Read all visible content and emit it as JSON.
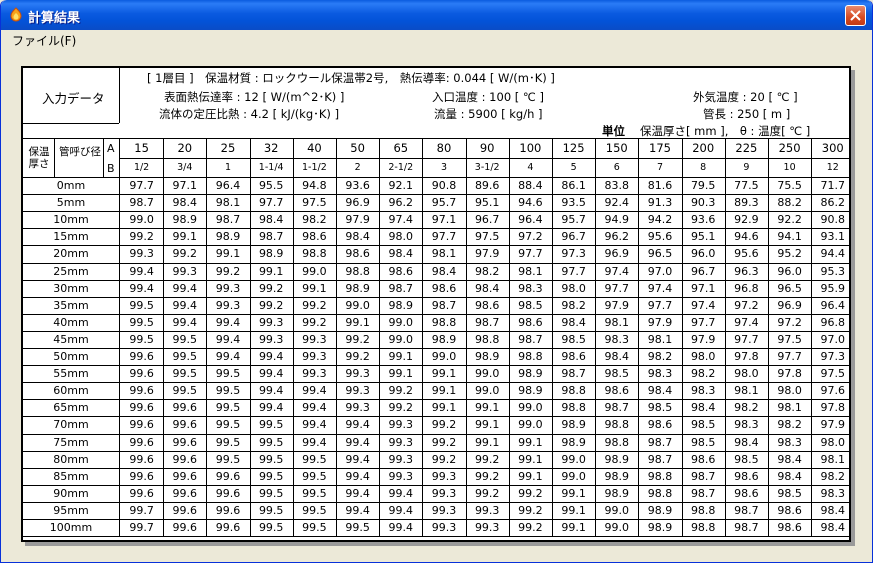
{
  "window": {
    "title": "計算結果"
  },
  "menu": {
    "file": "ファイル(F)"
  },
  "info": {
    "input_label": "入力データ",
    "line1": "[ 1層目 ]　保温材質 : ロックウール保温帯2号,　熱伝導率: 0.044 [ W/(m･K) ]",
    "surface": "表面熱伝達率 : 12 [ W/(m^2･K) ]",
    "inlet": "入口温度 : 100 [ ℃ ]",
    "outside": "外気温度 : 20 [ ℃ ]",
    "specific_heat": "流体の定圧比熱 : 4.2 [ kJ/(kg･K) ]",
    "flow": "流量 : 5900 [ kg/h ]",
    "length": "管長 : 250 [ m ]",
    "unit_label": "単位",
    "unit_text": "保温厚さ[ mm ],　θ : 温度[ ℃ ]"
  },
  "table": {
    "header_thickness": "保温厚さ",
    "header_pipe": "管呼び径",
    "row_a": "A",
    "row_b": "B",
    "sizes_a": [
      "15",
      "20",
      "25",
      "32",
      "40",
      "50",
      "65",
      "80",
      "90",
      "100",
      "125",
      "150",
      "175",
      "200",
      "225",
      "250",
      "300"
    ],
    "sizes_b": [
      "1/2",
      "3/4",
      "1",
      "1-1/4",
      "1-1/2",
      "2",
      "2-1/2",
      "3",
      "3-1/2",
      "4",
      "5",
      "6",
      "7",
      "8",
      "9",
      "10",
      "12"
    ],
    "rows": [
      {
        "label": "0mm",
        "values": [
          "97.7",
          "97.1",
          "96.4",
          "95.5",
          "94.8",
          "93.6",
          "92.1",
          "90.8",
          "89.6",
          "88.4",
          "86.1",
          "83.8",
          "81.6",
          "79.5",
          "77.5",
          "75.5",
          "71.7"
        ]
      },
      {
        "label": "5mm",
        "values": [
          "98.7",
          "98.4",
          "98.1",
          "97.7",
          "97.5",
          "96.9",
          "96.2",
          "95.7",
          "95.1",
          "94.6",
          "93.5",
          "92.4",
          "91.3",
          "90.3",
          "89.3",
          "88.2",
          "86.2"
        ]
      },
      {
        "label": "10mm",
        "values": [
          "99.0",
          "98.9",
          "98.7",
          "98.4",
          "98.2",
          "97.9",
          "97.4",
          "97.1",
          "96.7",
          "96.4",
          "95.7",
          "94.9",
          "94.2",
          "93.6",
          "92.9",
          "92.2",
          "90.8"
        ]
      },
      {
        "label": "15mm",
        "values": [
          "99.2",
          "99.1",
          "98.9",
          "98.7",
          "98.6",
          "98.4",
          "98.0",
          "97.7",
          "97.5",
          "97.2",
          "96.7",
          "96.2",
          "95.6",
          "95.1",
          "94.6",
          "94.1",
          "93.1"
        ]
      },
      {
        "label": "20mm",
        "values": [
          "99.3",
          "99.2",
          "99.1",
          "98.9",
          "98.8",
          "98.6",
          "98.4",
          "98.1",
          "97.9",
          "97.7",
          "97.3",
          "96.9",
          "96.5",
          "96.0",
          "95.6",
          "95.2",
          "94.4"
        ]
      },
      {
        "label": "25mm",
        "values": [
          "99.4",
          "99.3",
          "99.2",
          "99.1",
          "99.0",
          "98.8",
          "98.6",
          "98.4",
          "98.2",
          "98.1",
          "97.7",
          "97.4",
          "97.0",
          "96.7",
          "96.3",
          "96.0",
          "95.3"
        ]
      },
      {
        "label": "30mm",
        "values": [
          "99.4",
          "99.4",
          "99.3",
          "99.2",
          "99.1",
          "98.9",
          "98.7",
          "98.6",
          "98.4",
          "98.3",
          "98.0",
          "97.7",
          "97.4",
          "97.1",
          "96.8",
          "96.5",
          "95.9"
        ]
      },
      {
        "label": "35mm",
        "values": [
          "99.5",
          "99.4",
          "99.3",
          "99.2",
          "99.2",
          "99.0",
          "98.9",
          "98.7",
          "98.6",
          "98.5",
          "98.2",
          "97.9",
          "97.7",
          "97.4",
          "97.2",
          "96.9",
          "96.4"
        ]
      },
      {
        "label": "40mm",
        "values": [
          "99.5",
          "99.4",
          "99.4",
          "99.3",
          "99.2",
          "99.1",
          "99.0",
          "98.8",
          "98.7",
          "98.6",
          "98.4",
          "98.1",
          "97.9",
          "97.7",
          "97.4",
          "97.2",
          "96.8"
        ]
      },
      {
        "label": "45mm",
        "values": [
          "99.5",
          "99.5",
          "99.4",
          "99.3",
          "99.3",
          "99.2",
          "99.0",
          "98.9",
          "98.8",
          "98.7",
          "98.5",
          "98.3",
          "98.1",
          "97.9",
          "97.7",
          "97.5",
          "97.0"
        ]
      },
      {
        "label": "50mm",
        "values": [
          "99.6",
          "99.5",
          "99.4",
          "99.4",
          "99.3",
          "99.2",
          "99.1",
          "99.0",
          "98.9",
          "98.8",
          "98.6",
          "98.4",
          "98.2",
          "98.0",
          "97.8",
          "97.7",
          "97.3"
        ]
      },
      {
        "label": "55mm",
        "values": [
          "99.6",
          "99.5",
          "99.5",
          "99.4",
          "99.3",
          "99.3",
          "99.1",
          "99.1",
          "99.0",
          "98.9",
          "98.7",
          "98.5",
          "98.3",
          "98.2",
          "98.0",
          "97.8",
          "97.5"
        ]
      },
      {
        "label": "60mm",
        "values": [
          "99.6",
          "99.5",
          "99.5",
          "99.4",
          "99.4",
          "99.3",
          "99.2",
          "99.1",
          "99.0",
          "98.9",
          "98.8",
          "98.6",
          "98.4",
          "98.3",
          "98.1",
          "98.0",
          "97.6"
        ]
      },
      {
        "label": "65mm",
        "values": [
          "99.6",
          "99.6",
          "99.5",
          "99.4",
          "99.4",
          "99.3",
          "99.2",
          "99.1",
          "99.1",
          "99.0",
          "98.8",
          "98.7",
          "98.5",
          "98.4",
          "98.2",
          "98.1",
          "97.8"
        ]
      },
      {
        "label": "70mm",
        "values": [
          "99.6",
          "99.6",
          "99.5",
          "99.5",
          "99.4",
          "99.4",
          "99.3",
          "99.2",
          "99.1",
          "99.0",
          "98.9",
          "98.8",
          "98.6",
          "98.5",
          "98.3",
          "98.2",
          "97.9"
        ]
      },
      {
        "label": "75mm",
        "values": [
          "99.6",
          "99.6",
          "99.5",
          "99.5",
          "99.4",
          "99.4",
          "99.3",
          "99.2",
          "99.1",
          "99.1",
          "98.9",
          "98.8",
          "98.7",
          "98.5",
          "98.4",
          "98.3",
          "98.0"
        ]
      },
      {
        "label": "80mm",
        "values": [
          "99.6",
          "99.6",
          "99.5",
          "99.5",
          "99.5",
          "99.4",
          "99.3",
          "99.2",
          "99.2",
          "99.1",
          "99.0",
          "98.9",
          "98.7",
          "98.6",
          "98.5",
          "98.4",
          "98.1"
        ]
      },
      {
        "label": "85mm",
        "values": [
          "99.6",
          "99.6",
          "99.6",
          "99.5",
          "99.5",
          "99.4",
          "99.3",
          "99.3",
          "99.2",
          "99.1",
          "99.0",
          "98.9",
          "98.8",
          "98.7",
          "98.6",
          "98.4",
          "98.2"
        ]
      },
      {
        "label": "90mm",
        "values": [
          "99.6",
          "99.6",
          "99.6",
          "99.5",
          "99.5",
          "99.4",
          "99.4",
          "99.3",
          "99.2",
          "99.2",
          "99.1",
          "98.9",
          "98.8",
          "98.7",
          "98.6",
          "98.5",
          "98.3"
        ]
      },
      {
        "label": "95mm",
        "values": [
          "99.7",
          "99.6",
          "99.6",
          "99.5",
          "99.5",
          "99.4",
          "99.4",
          "99.3",
          "99.3",
          "99.2",
          "99.1",
          "99.0",
          "98.9",
          "98.8",
          "98.7",
          "98.6",
          "98.4"
        ]
      },
      {
        "label": "100mm",
        "values": [
          "99.7",
          "99.6",
          "99.6",
          "99.5",
          "99.5",
          "99.5",
          "99.4",
          "99.3",
          "99.3",
          "99.2",
          "99.1",
          "99.0",
          "98.9",
          "98.8",
          "98.7",
          "98.6",
          "98.4"
        ]
      }
    ]
  }
}
